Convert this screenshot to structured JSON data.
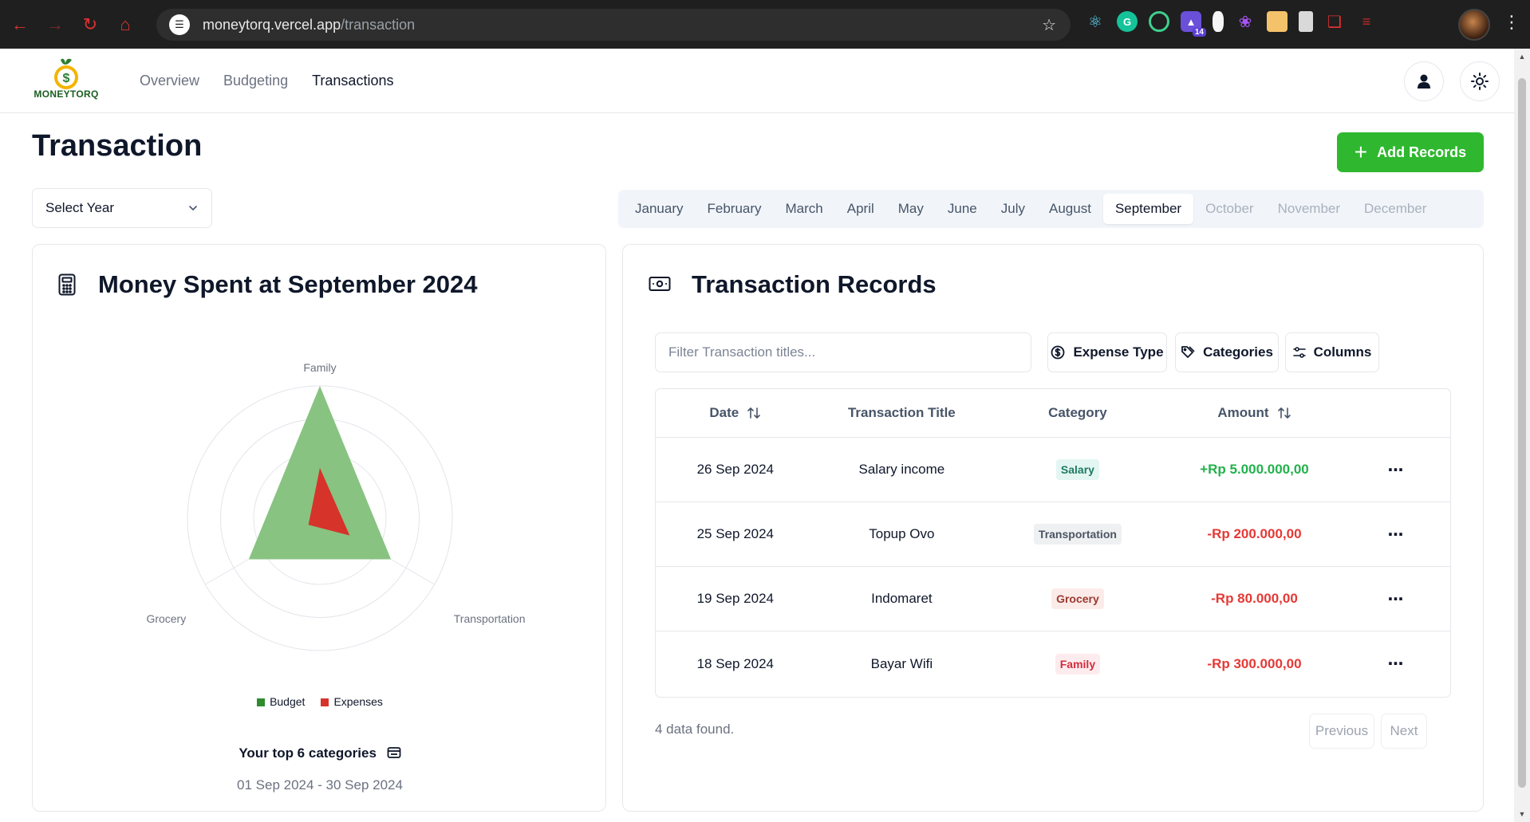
{
  "browser": {
    "url_host": "moneytorq.vercel.app",
    "url_path": "/transaction",
    "extension_badge": "14"
  },
  "app": {
    "brand": "MONEYTORQ",
    "nav": [
      {
        "label": "Overview"
      },
      {
        "label": "Budgeting"
      },
      {
        "label": "Transactions"
      }
    ],
    "icons": [
      "user-icon",
      "sun-icon"
    ]
  },
  "page": {
    "title": "Transaction",
    "add_button": "Add Records",
    "year_select": {
      "value": "Select Year"
    },
    "months": [
      {
        "label": "January",
        "state": "enabled"
      },
      {
        "label": "February",
        "state": "enabled"
      },
      {
        "label": "March",
        "state": "enabled"
      },
      {
        "label": "April",
        "state": "enabled"
      },
      {
        "label": "May",
        "state": "enabled"
      },
      {
        "label": "June",
        "state": "enabled"
      },
      {
        "label": "July",
        "state": "enabled"
      },
      {
        "label": "August",
        "state": "enabled"
      },
      {
        "label": "September",
        "state": "active"
      },
      {
        "label": "October",
        "state": "disabled"
      },
      {
        "label": "November",
        "state": "disabled"
      },
      {
        "label": "December",
        "state": "disabled"
      }
    ]
  },
  "spending_card": {
    "title": "Money Spent at September 2024",
    "chart_data": {
      "type": "radar",
      "axes": [
        "Family",
        "Transportation",
        "Grocery"
      ],
      "series": [
        {
          "name": "Budget",
          "color": "#82c07a",
          "values": [
            1.0,
            0.62,
            0.62
          ]
        },
        {
          "name": "Expenses",
          "color": "#d6332b",
          "values": [
            0.38,
            0.26,
            0.1
          ]
        }
      ],
      "rings": 4,
      "legend_position": "bottom"
    },
    "top_categories_label": "Your top 6 categories",
    "date_range": "01 Sep 2024 - 30 Sep 2024"
  },
  "records_card": {
    "title": "Transaction Records",
    "filter_placeholder": "Filter Transaction titles...",
    "buttons": {
      "expense_type": "Expense Type",
      "categories": "Categories",
      "columns": "Columns"
    },
    "columns": {
      "date": "Date",
      "title": "Transaction Title",
      "category": "Category",
      "amount": "Amount"
    },
    "rows": [
      {
        "date": "26 Sep 2024",
        "title": "Salary income",
        "category": "Salary",
        "amount": "+Rp 5.000.000,00",
        "type": "income"
      },
      {
        "date": "25 Sep 2024",
        "title": "Topup Ovo",
        "category": "Transportation",
        "amount": "-Rp 200.000,00",
        "type": "expense"
      },
      {
        "date": "19 Sep 2024",
        "title": "Indomaret",
        "category": "Grocery",
        "amount": "-Rp 80.000,00",
        "type": "expense"
      },
      {
        "date": "18 Sep 2024",
        "title": "Bayar Wifi",
        "category": "Family",
        "amount": "-Rp 300.000,00",
        "type": "expense"
      }
    ],
    "category_colors": {
      "Salary": {
        "bg": "#e3f6f2",
        "fg": "#1f7a63"
      },
      "Transportation": {
        "bg": "#eef0f2",
        "fg": "#4b5563"
      },
      "Grocery": {
        "bg": "#fbebe9",
        "fg": "#9a3b30"
      },
      "Family": {
        "bg": "#fdecee",
        "fg": "#d22d3d"
      }
    },
    "count_text": "4 data found.",
    "pagination": {
      "previous": "Previous",
      "next": "Next"
    }
  },
  "colors": {
    "primary_green": "#2fb82f",
    "income": "#22b14c",
    "expense": "#e53935"
  }
}
